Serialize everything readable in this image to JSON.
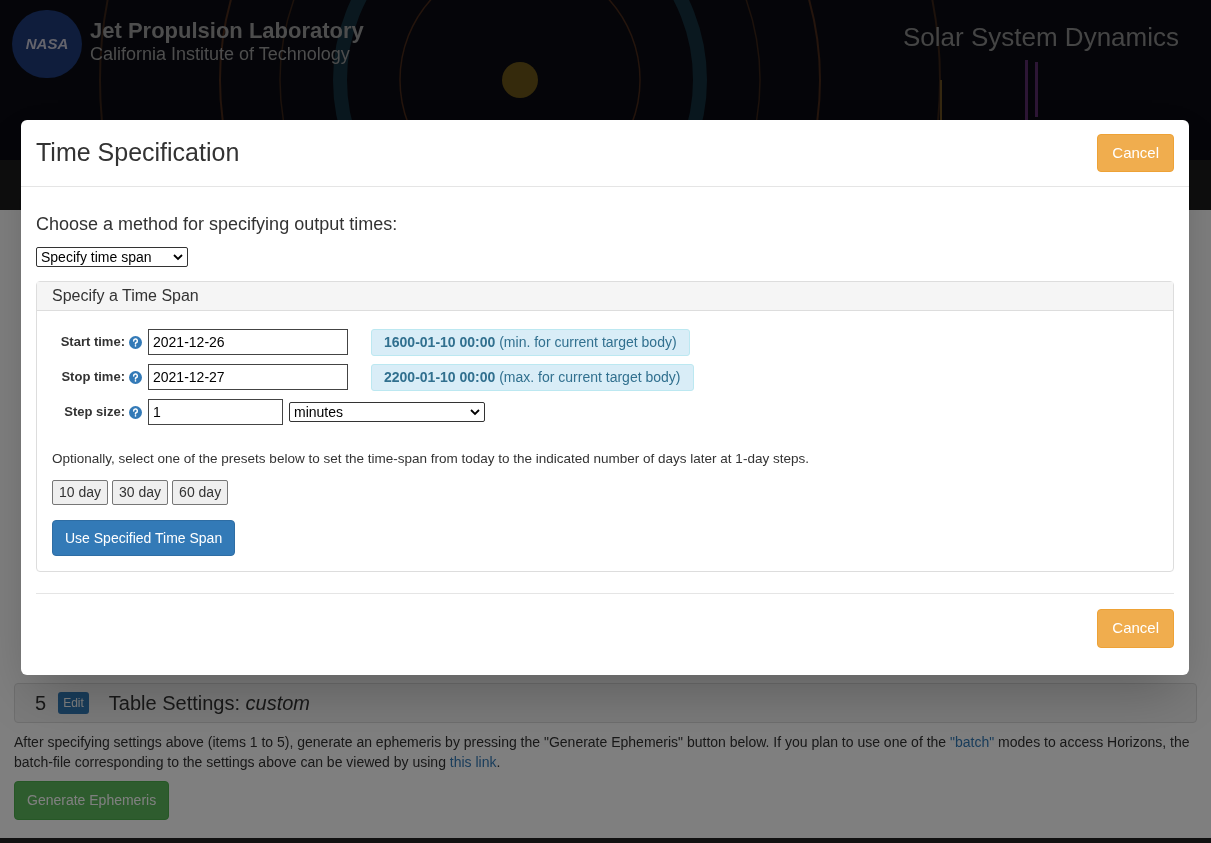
{
  "header": {
    "logo_text": "NASA",
    "title": "Jet Propulsion Laboratory",
    "subtitle": "California Institute of Technology",
    "site_name": "Solar System Dynamics"
  },
  "page": {
    "item": {
      "number": "5",
      "edit_label": "Edit",
      "label": "Table Settings: ",
      "value": "custom"
    },
    "paragraph": "After specifying settings above (items 1 to 5), generate an ephemeris by pressing the \"Generate Ephemeris\" button below. If you plan to use one of the ",
    "batch_link": "\"batch\"",
    "paragraph_2": " modes to access Horizons, the batch-file corresponding to the settings above can be viewed by using ",
    "this_link": "this link",
    "paragraph_end": ".",
    "generate_button": "Generate Ephemeris"
  },
  "modal": {
    "title": "Time Specification",
    "cancel_top": "Cancel",
    "prompt": "Choose a method for specifying output times:",
    "method": "Specify time span",
    "panel": {
      "title": "Specify a Time Span",
      "rows": [
        {
          "label": "Start time:",
          "value": "2021-12-26",
          "limit": "1600-01-10 00:00",
          "limit_note": " (min. for current target body)"
        },
        {
          "label": "Stop time:",
          "value": "2021-12-27",
          "limit": "2200-01-10 00:00",
          "limit_note": " (max. for current target body)"
        }
      ],
      "step": {
        "label": "Step size:",
        "value": "1",
        "unit": "minutes"
      },
      "presets_hint": "Optionally, select one of the presets below to set the time-span from today to the indicated number of days later at 1-day steps.",
      "presets": [
        "10 day",
        "30 day",
        "60 day"
      ],
      "submit": "Use Specified Time Span"
    },
    "cancel_bottom": "Cancel"
  }
}
